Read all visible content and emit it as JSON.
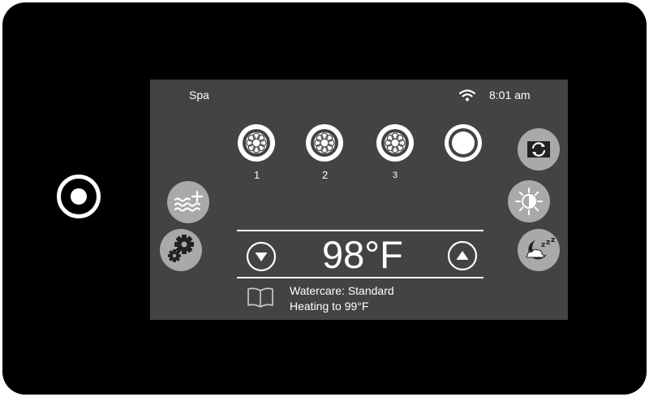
{
  "header": {
    "mode_label": "Spa",
    "time": "8:01 am"
  },
  "pumps": [
    {
      "label": "1"
    },
    {
      "label": "2"
    },
    {
      "label": "3"
    },
    {
      "label": ""
    }
  ],
  "temperature": {
    "current": "98°F"
  },
  "status": {
    "watercare": "Watercare: Standard",
    "heating": "Heating to 99°F"
  },
  "icons": {
    "device_home": "home-button",
    "wifi": "wifi-icon",
    "water_care": "waves-plus-icon",
    "settings": "gear-icon",
    "invert": "flip-screen-icon",
    "brightness": "sun-icon",
    "sleep": "moon-sleep-icon",
    "decrease": "down-arrow-icon",
    "increase": "up-arrow-icon",
    "manual": "book-icon"
  },
  "colors": {
    "bezel": "#000000",
    "screen": "#434343",
    "button": "#a9a9a9",
    "foreground": "#ffffff"
  }
}
